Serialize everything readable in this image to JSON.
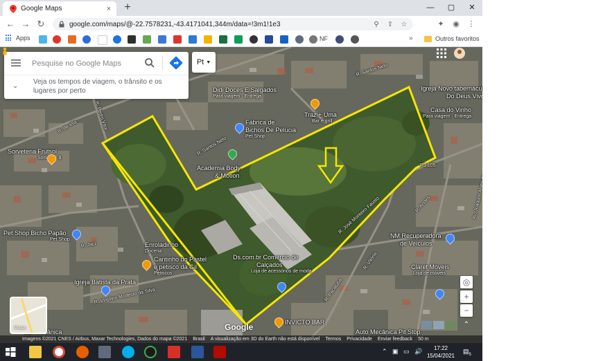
{
  "tab": {
    "title": "Google Maps",
    "close": "×",
    "new": "+",
    "favicon": "google-maps-pin-icon"
  },
  "window": {
    "minimize": "—",
    "maximize": "▢",
    "close": "✕"
  },
  "toolbar": {
    "back": "←",
    "forward": "→",
    "reload": "↻",
    "url": "google.com/maps/@-22.7578231,-43.4171041,344m/data=!3m1!1e3",
    "menu": "⋮"
  },
  "bookmarks": {
    "apps": "Apps",
    "nf": "NF",
    "more": "»",
    "outros": "Outros favoritos"
  },
  "search": {
    "placeholder": "Pesquise no Google Maps",
    "hint": "Veja os tempos de viagem, o trânsito e os lugares por perto",
    "lang": "Pt"
  },
  "map": {
    "labels": [
      {
        "id": "didi",
        "text": "Didi Doces E Salgados"
      },
      {
        "id": "didi_sub",
        "text": "Para viagem · Entrega"
      },
      {
        "id": "traz",
        "text": "Traz + Uma"
      },
      {
        "id": "traz_sub",
        "text": "Bar e grill"
      },
      {
        "id": "fabrica",
        "text": "Fábrica de"
      },
      {
        "id": "fabrica2",
        "text": "Bichos De Pelúcia"
      },
      {
        "id": "fabrica_sub",
        "text": "Pet Shop"
      },
      {
        "id": "academia",
        "text": "Academia Body"
      },
      {
        "id": "academia2",
        "text": "& Motion"
      },
      {
        "id": "igreja_novo",
        "text": "Igreja Novo tabernáculo"
      },
      {
        "id": "igreja_novo2",
        "text": "Do Deus Vivo"
      },
      {
        "id": "casa",
        "text": "Casa do Vinho"
      },
      {
        "id": "casa_sub",
        "text": "Para viagem · Entrega"
      },
      {
        "id": "sorveteria",
        "text": "Sorveteria Frutsol"
      },
      {
        "id": "sorveteria_sub",
        "text": "Sorvete · $"
      },
      {
        "id": "petshop",
        "text": "Pet Shop Bicho Papão"
      },
      {
        "id": "petshop_sub",
        "text": "Pet Shop"
      },
      {
        "id": "enroladinho",
        "text": "Enroladinho"
      },
      {
        "id": "enroladinho_sub",
        "text": "Doceria"
      },
      {
        "id": "cantinho",
        "text": "Cantinho do Pastel"
      },
      {
        "id": "cantinho2",
        "text": "e petisco da Gil"
      },
      {
        "id": "cantinho_sub",
        "text": "Petiscos"
      },
      {
        "id": "igreja_batista",
        "text": "Igreja Batista da Prata"
      },
      {
        "id": "ds",
        "text": "Ds.com.br Comercio de"
      },
      {
        "id": "ds2",
        "text": "Calçados"
      },
      {
        "id": "ds_sub",
        "text": "Loja de acessórios de moda"
      },
      {
        "id": "nm",
        "text": "NM Recuperadora"
      },
      {
        "id": "nm2",
        "text": "de Veículos"
      },
      {
        "id": "claret",
        "text": "Claret Móveis"
      },
      {
        "id": "claret_sub",
        "text": "Loja de móveis"
      },
      {
        "id": "invicto",
        "text": "INVICTO BAR"
      },
      {
        "id": "auto",
        "text": "Auto Mecânica Pit Stop"
      },
      {
        "id": "van",
        "text": "Van Mecânica"
      },
      {
        "id": "r_santos_neto",
        "text": "R. Santos Neto"
      },
      {
        "id": "r_santos_neto2",
        "text": "R. Santos Neto"
      },
      {
        "id": "r_jaci",
        "text": "R. Jaci"
      },
      {
        "id": "r_vitoria",
        "text": "R. Vitória"
      },
      {
        "id": "r_virgilino",
        "text": "R. Virgílino Modesto da Silva"
      },
      {
        "id": "r_pacatuba",
        "text": "R. Pacatuba"
      },
      {
        "id": "r_jose",
        "text": "R. José Monteiro Fausto"
      },
      {
        "id": "r_jacinto",
        "text": "Av. Joaquim Alves de..."
      },
      {
        "id": "r_andes",
        "text": "R. Andes"
      },
      {
        "id": "r_105",
        "text": "RJ-105"
      },
      {
        "id": "r_vila",
        "text": "R. de Vila"
      },
      {
        "id": "r_pedro",
        "text": "R. Pedro Vitor"
      }
    ],
    "layer_label": "Mapa",
    "google": "Google",
    "zoom_in": "+",
    "zoom_out": "−",
    "expand": "⌃"
  },
  "attribution": {
    "imagery": "Imagens ©2021 CNES / Airbus, Maxar Technologies, Dados do mapa ©2021",
    "country": "Brasil",
    "notice": "A visualização em 3D do Earth não está disponível",
    "terms": "Termos",
    "privacy": "Privacidade",
    "feedback": "Enviar feedback",
    "scale": "50 m"
  },
  "taskbar": {
    "time": "17:22",
    "date": "15/04/2021",
    "tray_up": "⌃",
    "notif_count": "5"
  },
  "colors": {
    "boundary": "#f5e600",
    "pin_orange": "#f29900",
    "pin_blue": "#4285f4",
    "pin_green": "#34a853"
  }
}
